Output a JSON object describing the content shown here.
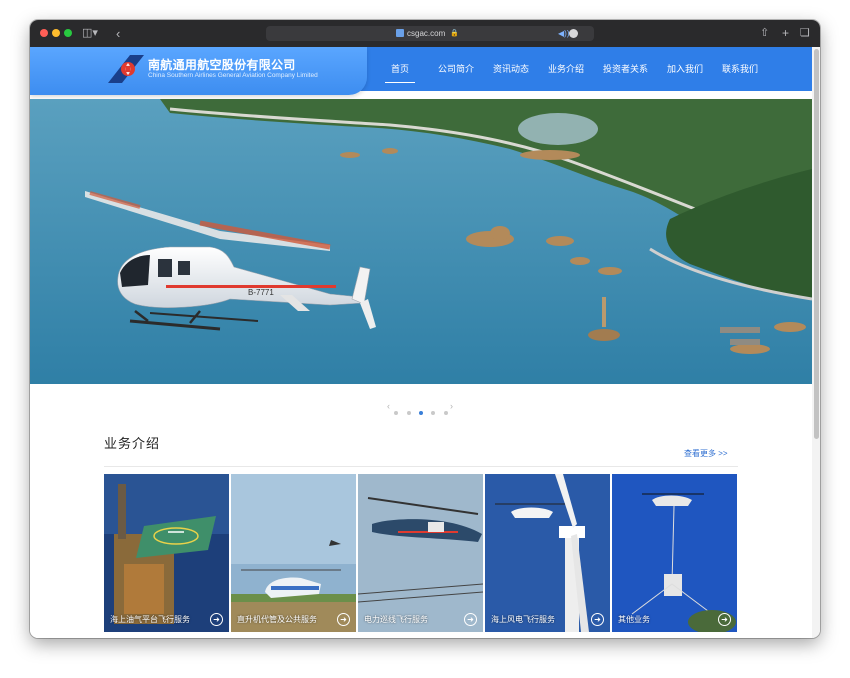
{
  "browser": {
    "url": "csgac.com",
    "sidebar_icon": "sidebar-icon",
    "back_icon": "back-icon",
    "share_icon": "share-icon",
    "new_tab_icon": "plus-icon",
    "tabs_icon": "tabs-overview-icon"
  },
  "site": {
    "logo_cn": "南航通用航空股份有限公司",
    "logo_en": "China Southern Airlines General Aviation Company Limited",
    "nav": [
      {
        "label": "首页"
      },
      {
        "label": "公司简介"
      },
      {
        "label": "资讯动态"
      },
      {
        "label": "业务介绍"
      },
      {
        "label": "投资者关系"
      },
      {
        "label": "加入我们"
      },
      {
        "label": "联系我们"
      }
    ]
  },
  "hero": {
    "helicopter_reg": "B-7771",
    "slide_count": 5,
    "active_slide": 3
  },
  "business": {
    "title": "业务介绍",
    "more": "查看更多 >>",
    "cards": [
      {
        "label": "海上油气平台飞行服务"
      },
      {
        "label": "直升机代管及公共服务"
      },
      {
        "label": "电力巡线飞行服务"
      },
      {
        "label": "海上风电飞行服务"
      },
      {
        "label": "其他业务"
      }
    ]
  },
  "colors": {
    "brand_blue": "#2f7ee8",
    "logo_red": "#e03a2f",
    "sea": "#4f97b8"
  }
}
